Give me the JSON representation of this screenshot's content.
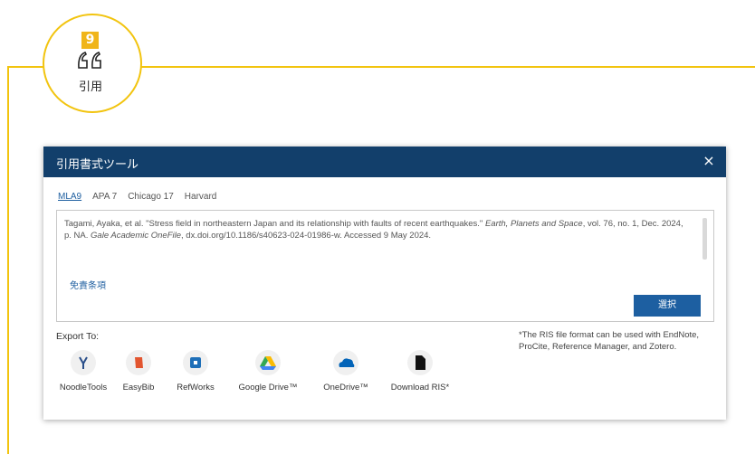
{
  "step": {
    "number": "9",
    "label": "引用"
  },
  "dialog": {
    "title": "引用書式ツール",
    "close": "×",
    "tabs": [
      "MLA9",
      "APA 7",
      "Chicago 17",
      "Harvard"
    ],
    "active_tab": "MLA9",
    "citation": {
      "part1": "Tagami, Ayaka, et al. \"Stress field in northeastern Japan and its relationship with faults of recent earthquakes.\" ",
      "journal": "Earth, Planets and Space",
      "part2": ", vol. 76, no. 1, Dec. 2024, p. NA. ",
      "database": "Gale Academic OneFile",
      "part3": ", dx.doi.org/10.1186/s40623-024-01986-w. Accessed 9 May 2024."
    },
    "disclaimer": "免責条項",
    "select_button": "選択",
    "export_label": "Export To:",
    "ris_note": "*The RIS file format can be used with EndNote, ProCite, Reference Manager, and Zotero.",
    "export_targets": [
      {
        "label": "NoodleTools",
        "icon": "noodletools-icon",
        "color": "#2a4f8a"
      },
      {
        "label": "EasyBib",
        "icon": "easybib-icon",
        "color": "#e2552f"
      },
      {
        "label": "RefWorks",
        "icon": "refworks-icon",
        "color": "#1e6fb8"
      },
      {
        "label": "Google Drive™",
        "icon": "google-drive-icon",
        "color": "#34a853"
      },
      {
        "label": "OneDrive™",
        "icon": "onedrive-icon",
        "color": "#0364b8"
      },
      {
        "label": "Download RIS*",
        "icon": "ris-file-icon",
        "color": "#111111"
      }
    ]
  }
}
